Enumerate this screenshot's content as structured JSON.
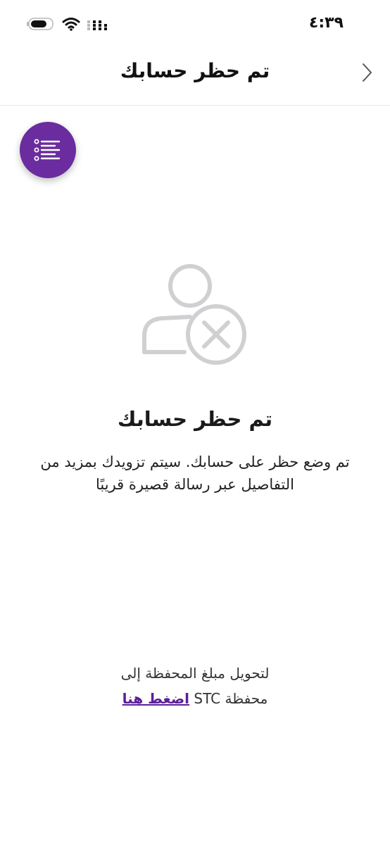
{
  "status_bar": {
    "time": "٤:٣٩"
  },
  "header": {
    "title": "تم حظر حسابك"
  },
  "content": {
    "title": "تم حظر حسابك",
    "message": "تم وضع حظر على حسابك. سيتم تزويدك بمزيد من التفاصيل عبر رسالة قصيرة قريبًا"
  },
  "transfer": {
    "line1": "لتحويل مبلغ المحفظة إلى",
    "line2_prefix": "محفظة STC",
    "link_label": "اضغط هنا"
  },
  "colors": {
    "brand_purple": "#6a2c9e",
    "link_purple": "#5b1f96",
    "illustration_gray": "#d0d0d3"
  },
  "icons": {
    "back": "chevron-right-icon",
    "menu": "list-icon",
    "illustration": "user-blocked-icon",
    "wifi": "wifi-icon",
    "battery": "battery-icon",
    "signal": "signal-icon"
  }
}
